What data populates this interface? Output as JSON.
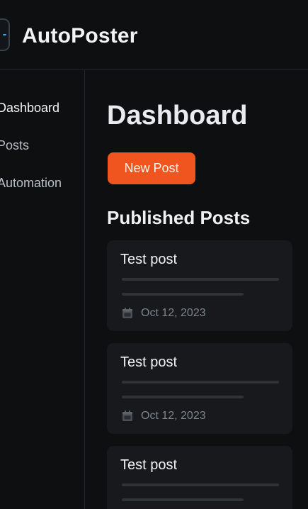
{
  "header": {
    "app_title": "AutoPoster"
  },
  "sidebar": {
    "items": [
      {
        "label": "Dashboard",
        "active": true
      },
      {
        "label": "Posts",
        "active": false
      },
      {
        "label": "Automation",
        "active": false
      }
    ]
  },
  "main": {
    "page_title": "Dashboard",
    "new_post_label": "New Post",
    "section_title": "Published Posts",
    "posts": [
      {
        "title": "Test post",
        "date": "Oct 12, 2023"
      },
      {
        "title": "Test post",
        "date": "Oct 12, 2023"
      },
      {
        "title": "Test post"
      }
    ]
  },
  "colors": {
    "background": "#0d0f11",
    "card": "#17191c",
    "accent": "#f0541f",
    "logo_accent": "#4aa3d8"
  },
  "icons": {
    "logo": "app-logo-icon",
    "post_date": "calendar-icon"
  }
}
